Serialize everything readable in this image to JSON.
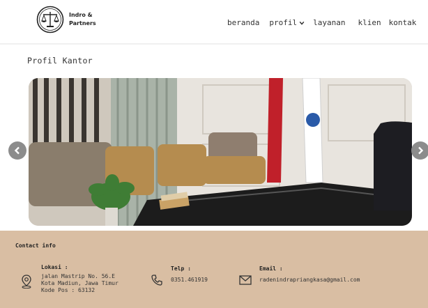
{
  "brand": {
    "line1": "Indro &",
    "line2": "Partners"
  },
  "nav": {
    "beranda": "beranda",
    "profil": "profil",
    "layanan": "layanan",
    "klien": "klien",
    "kontak": "kontak"
  },
  "main": {
    "title": "Profil Kantor"
  },
  "footer": {
    "title": "Contact info",
    "lokasi": {
      "label": "Lokasi :",
      "lines": [
        "jalan Mastrip No. 56.E",
        "Kota Madiun, Jawa Timur",
        "Kode Pos : 63132"
      ]
    },
    "telp": {
      "label": "Telp :",
      "value": "0351.461919"
    },
    "email": {
      "label": "Email :",
      "value": "radenindrapriangkasa@gmail.com"
    }
  },
  "colors": {
    "footer_bg": "#d9bea3",
    "arrow_bg": "#8c8c8c",
    "flag_red": "#c0202a",
    "flag_blue": "#2a5aa8"
  }
}
